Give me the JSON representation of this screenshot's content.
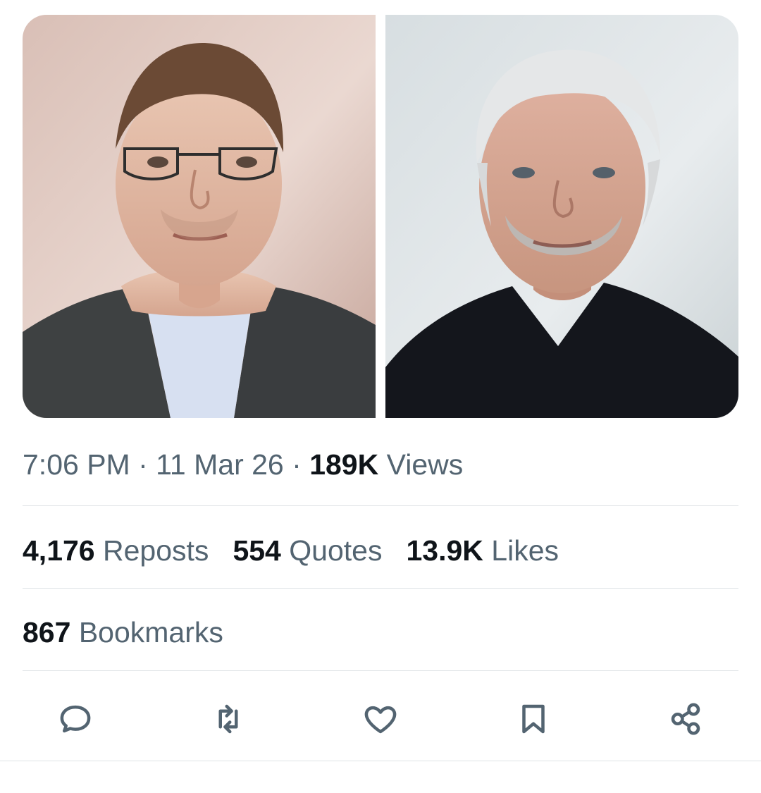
{
  "tweet": {
    "media": [
      {
        "name": "left-photo"
      },
      {
        "name": "right-photo"
      }
    ],
    "time": "7:06 PM",
    "separator": "·",
    "date": "11 Mar 26",
    "views_value": "189K",
    "views_label": "Views",
    "stats": {
      "reposts_value": "4,176",
      "reposts_label": "Reposts",
      "quotes_value": "554",
      "quotes_label": "Quotes",
      "likes_value": "13.9K",
      "likes_label": "Likes",
      "bookmarks_value": "867",
      "bookmarks_label": "Bookmarks"
    },
    "actions": [
      {
        "icon": "reply-icon"
      },
      {
        "icon": "repost-icon"
      },
      {
        "icon": "like-icon"
      },
      {
        "icon": "bookmark-icon"
      },
      {
        "icon": "share-icon"
      }
    ],
    "colors": {
      "text_primary": "#0f1419",
      "text_secondary": "#536471",
      "divider": "#dfe3e6"
    }
  }
}
